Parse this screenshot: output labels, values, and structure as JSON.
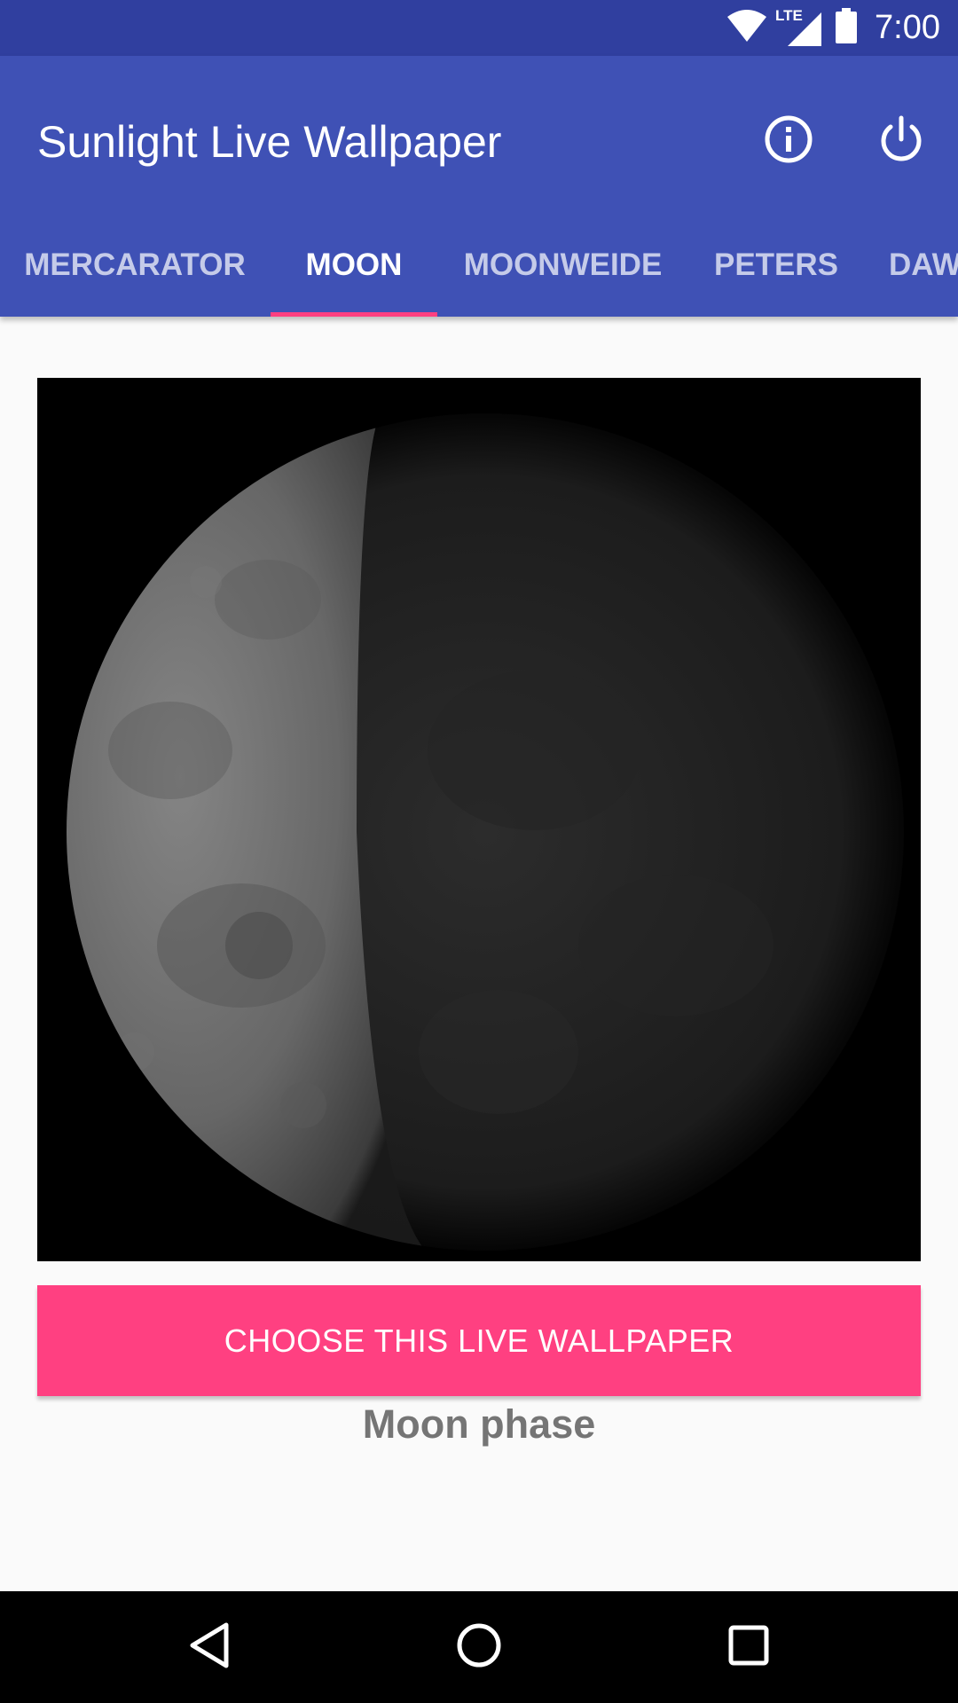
{
  "status_bar": {
    "time": "7:00",
    "network_label": "LTE",
    "icons": [
      "wifi-icon",
      "lte-signal-icon",
      "battery-icon"
    ]
  },
  "app_bar": {
    "title": "Sunlight Live Wallpaper",
    "actions": [
      "info-icon",
      "power-icon"
    ]
  },
  "tabs": [
    {
      "label": "MERCARATOR",
      "active": false
    },
    {
      "label": "MOON",
      "active": true
    },
    {
      "label": "MOONWEIDE",
      "active": false
    },
    {
      "label": "PETERS",
      "active": false
    },
    {
      "label": "DAW",
      "active": false
    }
  ],
  "main": {
    "button_label": "CHOOSE THIS LIVE WALLPAPER",
    "caption": "Moon phase"
  },
  "nav_bar": {
    "buttons": [
      "back-icon",
      "home-icon",
      "recents-icon"
    ]
  },
  "colors": {
    "status_bar": "#303f9f",
    "primary": "#3f51b5",
    "accent": "#ff4081",
    "background": "#fafafa"
  }
}
